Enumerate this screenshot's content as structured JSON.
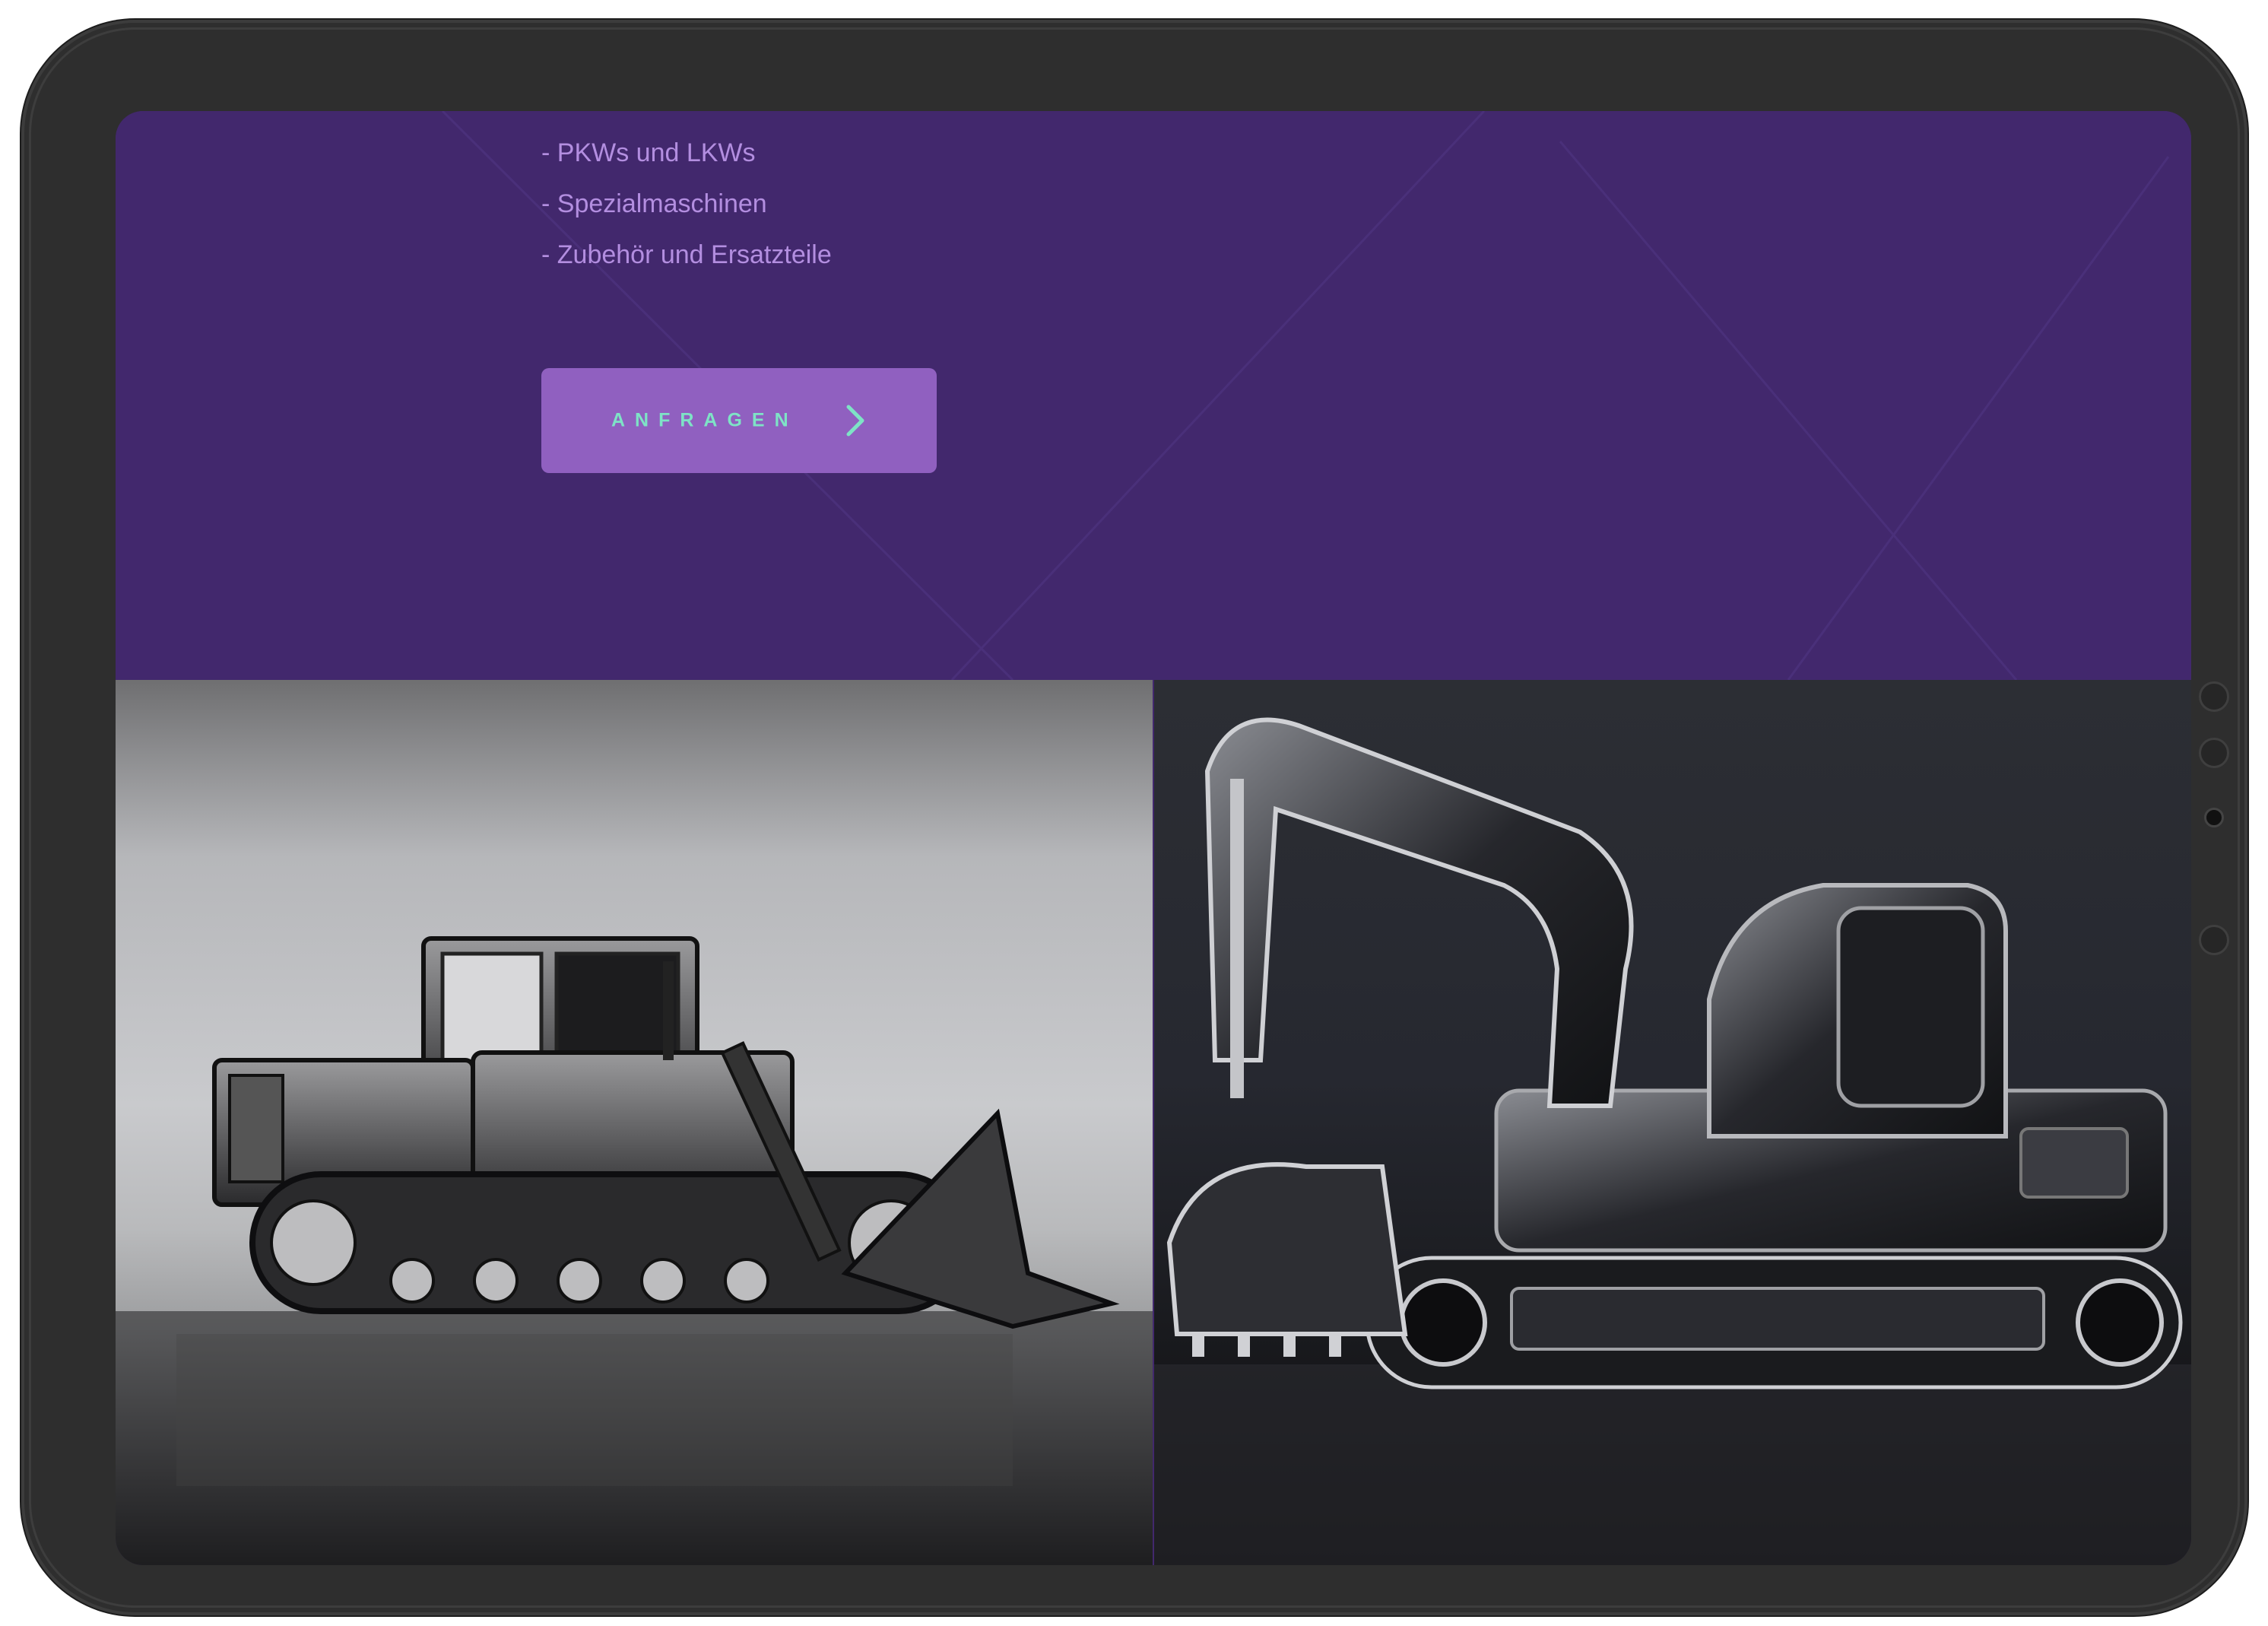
{
  "hero": {
    "features": [
      "- PKWs und LKWs",
      "- Spezialmaschinen",
      "- Zubehör und Ersatzteile"
    ],
    "cta_label": "ANFRAGEN",
    "colors": {
      "background": "#42286d",
      "list_text": "#b38ee0",
      "button": "#9060c0",
      "button_text": "#7ee3c6"
    }
  },
  "gallery": {
    "images": [
      {
        "subject": "bulldozer",
        "icon": "bulldozer-image"
      },
      {
        "subject": "excavator",
        "icon": "excavator-image"
      }
    ]
  }
}
